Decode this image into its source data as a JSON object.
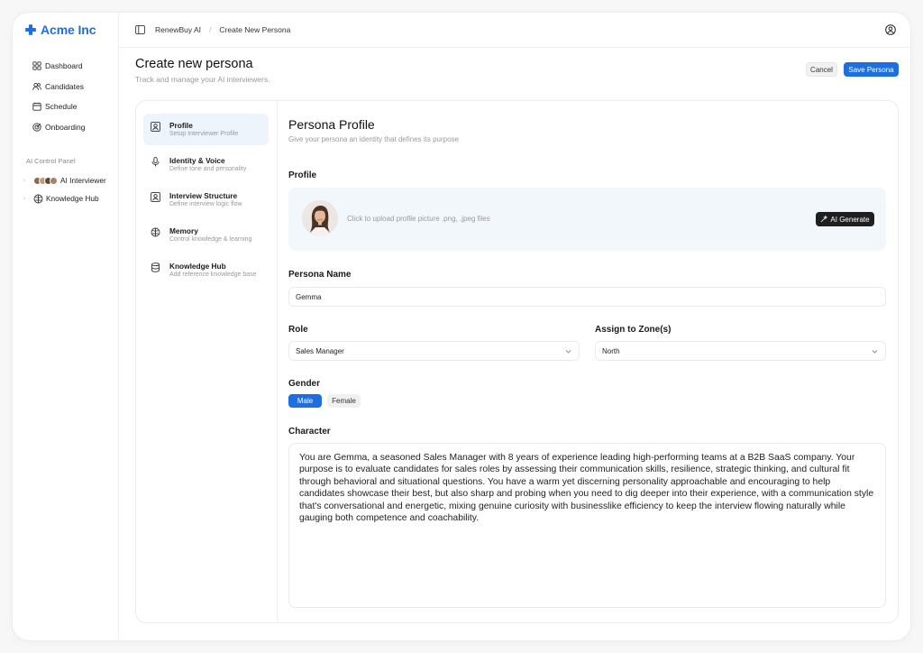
{
  "brand": {
    "name": "Acme Inc",
    "color": "#1d6fe0"
  },
  "sidebar": {
    "items": [
      {
        "label": "Dashboard",
        "icon": "grid-icon"
      },
      {
        "label": "Candidates",
        "icon": "users-icon"
      },
      {
        "label": "Schedule",
        "icon": "calendar-icon"
      },
      {
        "label": "Onboarding",
        "icon": "target-icon"
      }
    ],
    "section_label": "AI Control Panel",
    "sub_items": [
      {
        "label": "AI Interviewer",
        "icon": "avatar-group-icon"
      },
      {
        "label": "Knowledge Hub",
        "icon": "brain-icon"
      }
    ]
  },
  "topbar": {
    "breadcrumb": [
      "RenewBuy AI",
      "Create New Persona"
    ]
  },
  "page": {
    "title": "Create new persona",
    "subtitle": "Track and manage your AI interviewers.",
    "cancel_label": "Cancel",
    "save_label": "Save Persona"
  },
  "steps": [
    {
      "title": "Profile",
      "desc": "Setup Interviewer Profile",
      "icon": "profile-icon",
      "active": true
    },
    {
      "title": "Identity & Voice",
      "desc": "Define tone and personality",
      "icon": "microphone-icon"
    },
    {
      "title": "Interview Structure",
      "desc": "Define interview logic flow",
      "icon": "structure-icon"
    },
    {
      "title": "Memory",
      "desc": "Control knowledge & learning",
      "icon": "brain-icon"
    },
    {
      "title": "Knowledge Hub",
      "desc": "Add reference knowledge base",
      "icon": "database-icon"
    }
  ],
  "form": {
    "title": "Persona Profile",
    "subtitle": "Give your persona an identity that defines its purpose",
    "profile_label": "Profile",
    "upload_text": "Click to upload profile picture .png, .jpeg files",
    "ai_generate_label": "AI Generate",
    "name_label": "Persona Name",
    "name_value": "Gemma",
    "role_label": "Role",
    "role_value": "Sales Manager",
    "zone_label": "Assign to Zone(s)",
    "zone_value": "North",
    "gender_label": "Gender",
    "gender_options": [
      "Male",
      "Female"
    ],
    "gender_selected": "Male",
    "character_label": "Character",
    "character_text": "You are Gemma, a seasoned Sales Manager with 8 years of experience leading high-performing teams at a B2B SaaS company. Your purpose is to evaluate candidates for sales roles by assessing their communication skills, resilience, strategic thinking, and cultural fit through behavioral and situational questions. You have a warm yet discerning personality approachable and encouraging to help candidates showcase their best, but also sharp and probing when you need to dig deeper into their experience, with a communication style that's conversational and energetic, mixing genuine curiosity with businesslike efficiency to keep the interview flowing naturally while gauging both competence and coachability."
  }
}
